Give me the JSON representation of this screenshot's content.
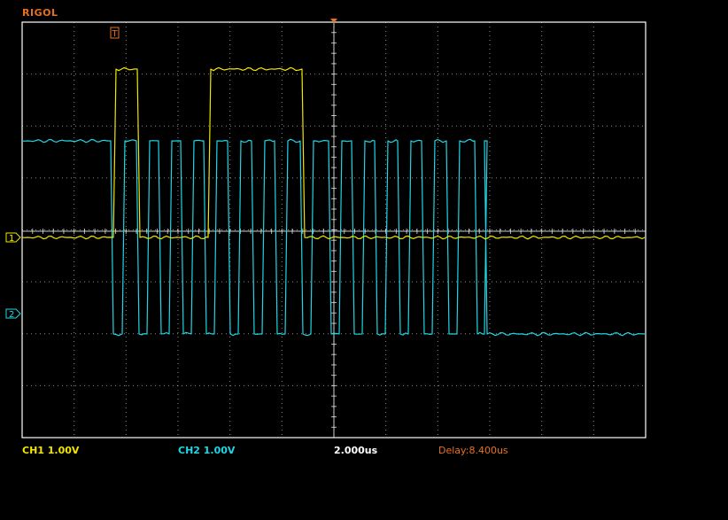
{
  "brand": "RIGOL",
  "trigger_marker": "T",
  "ch1_marker": "1",
  "ch2_marker": "2",
  "status": {
    "ch1": "CH1 1.00V",
    "ch2": "CH2 1.00V",
    "timebase": "2.000us",
    "delay": "Delay:8.400us"
  },
  "colors": {
    "ch1": "#f2e600",
    "ch2": "#1fd7e6",
    "accent": "#e8701c",
    "grid": "#ffffff",
    "background": "#000000"
  },
  "ch1_levels": [
    "low",
    "high",
    "low",
    "high",
    "low"
  ],
  "ch2_levels": [
    "high",
    "low",
    "high",
    "low",
    "high",
    "low",
    "high",
    "low",
    "high",
    "low",
    "high",
    "low",
    "high",
    "low",
    "high",
    "low",
    "high",
    "low",
    "high",
    "low",
    "high",
    "low",
    "high",
    "low",
    "high",
    "low",
    "high",
    "low",
    "high",
    "low",
    "high",
    "low",
    "high",
    "low",
    "high"
  ]
}
